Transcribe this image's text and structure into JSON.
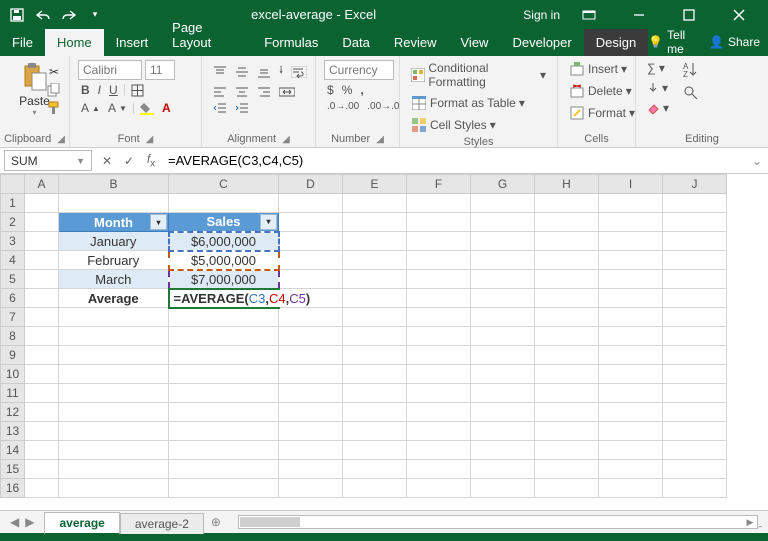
{
  "titlebar": {
    "title": "excel-average - Excel",
    "signin": "Sign in",
    "share": "Share"
  },
  "tabs": {
    "file": "File",
    "home": "Home",
    "insert": "Insert",
    "pagelayout": "Page Layout",
    "formulas": "Formulas",
    "data": "Data",
    "review": "Review",
    "view": "View",
    "developer": "Developer",
    "design": "Design",
    "tellme": "Tell me"
  },
  "ribbon": {
    "clipboard": {
      "paste": "Paste",
      "label": "Clipboard"
    },
    "font": {
      "name": "Calibri",
      "size": "11",
      "label": "Font"
    },
    "alignment": {
      "label": "Alignment"
    },
    "number": {
      "format": "Currency",
      "label": "Number"
    },
    "styles": {
      "cond": "Conditional Formatting",
      "table": "Format as Table",
      "cell": "Cell Styles",
      "label": "Styles"
    },
    "cells": {
      "insert": "Insert",
      "delete": "Delete",
      "format": "Format",
      "label": "Cells"
    },
    "editing": {
      "label": "Editing"
    }
  },
  "namebox": "SUM",
  "formula": "=AVERAGE(C3,C4,C5)",
  "columns": [
    "A",
    "B",
    "C",
    "D",
    "E",
    "F",
    "G",
    "H",
    "I",
    "J"
  ],
  "rows": [
    "1",
    "2",
    "3",
    "4",
    "5",
    "6",
    "7",
    "8",
    "9",
    "10",
    "11",
    "12",
    "13",
    "14",
    "15",
    "16"
  ],
  "table": {
    "hdr_month": "Month",
    "hdr_sales": "Sales",
    "r3_b": "January",
    "r3_c": "$6,000,000",
    "r4_b": "February",
    "r4_c": "$5,000,000",
    "r5_b": "March",
    "r5_c": "$7,000,000",
    "r6_b": "Average"
  },
  "editing_formula": {
    "pre": "=AVERAGE(",
    "c3": "C3",
    "s1": ",",
    "c4": "C4",
    "s2": ",",
    "c5": "C5",
    "post": ")"
  },
  "sheets": {
    "s1": "average",
    "s2": "average-2"
  },
  "colw": {
    "A": 34,
    "B": 110,
    "C": 110,
    "rest": 64
  }
}
